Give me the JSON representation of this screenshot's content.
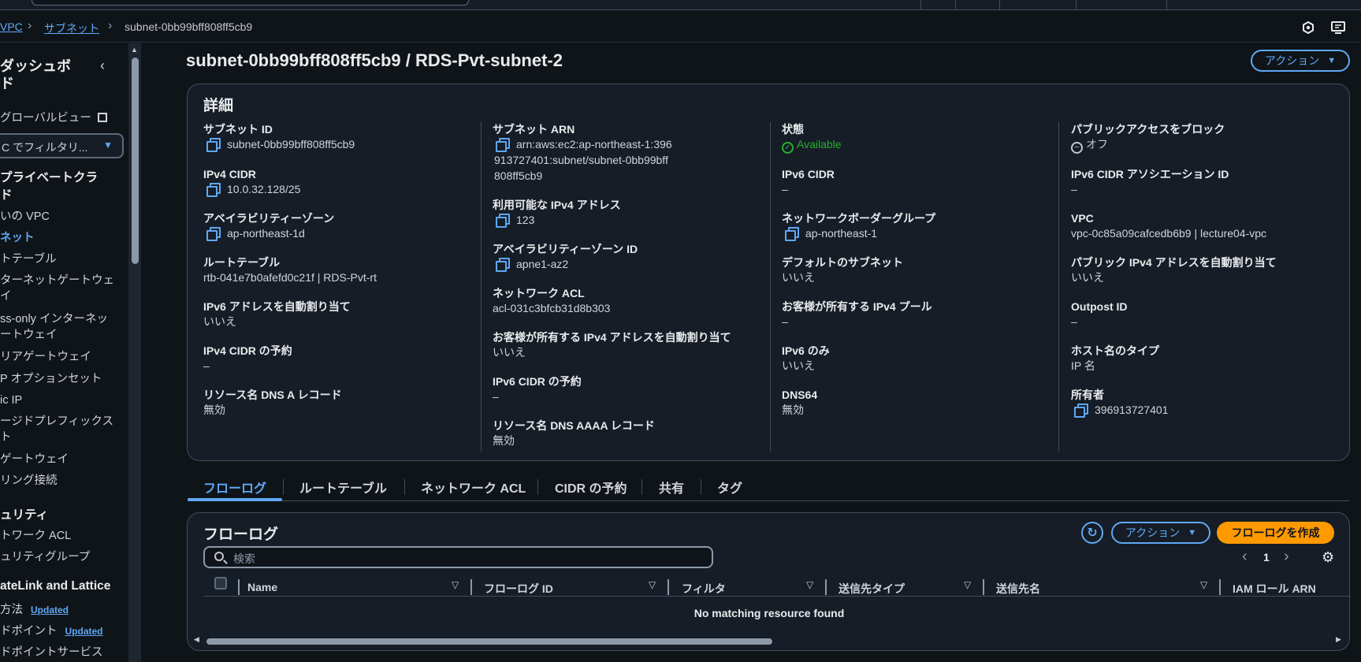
{
  "breadcrumb": {
    "vpc": "VPC",
    "subnets": "サブネット",
    "current": "subnet-0bb99bff808ff5cb9"
  },
  "sidebar": {
    "title": "ダッシュボ",
    "title2": "ド",
    "global_view": "グローバルビュー",
    "filter": "C でフィルタリ...",
    "section_private": "プライベートクラ",
    "section_private2": "ド",
    "items": [
      "いの VPC",
      "ネット",
      "トテーブル",
      "ターネットゲートウェ",
      "イ",
      "ss-only インターネッ",
      "ートウェイ",
      "リアゲートウェイ",
      "P オプションセット",
      "ic IP",
      "ージドプレフィックス",
      "ト",
      "ゲートウェイ",
      "リング接続"
    ],
    "section_security": "ュリティ",
    "security_items": [
      "トワーク ACL",
      "ュリティグループ"
    ],
    "section_privatelink": "ateLink and Lattice",
    "pl_items": [
      "方法",
      "ドポイント",
      "ドポイントサービス"
    ],
    "updated": "Updated"
  },
  "page": {
    "title": "subnet-0bb99bff808ff5cb9 / RDS-Pvt-subnet-2",
    "actions": "アクション"
  },
  "details": {
    "heading": "詳細",
    "col1": [
      {
        "label": "サブネット ID",
        "value": "subnet-0bb99bff808ff5cb9",
        "copy": true
      },
      {
        "label": "IPv4 CIDR",
        "value": "10.0.32.128/25",
        "copy": true
      },
      {
        "label": "アベイラビリティーゾーン",
        "value": "ap-northeast-1d",
        "copy": true
      },
      {
        "label": "ルートテーブル",
        "value": "rtb-041e7b0afefd0c21f | RDS-Pvt-rt",
        "link": true
      },
      {
        "label": "IPv6 アドレスを自動割り当て",
        "value": "いいえ"
      },
      {
        "label": "IPv4 CIDR の予約",
        "value": "–"
      },
      {
        "label": "リソース名 DNS A レコード",
        "value": "無効"
      }
    ],
    "col2": [
      {
        "label": "サブネット ARN",
        "value": "arn:aws:ec2:ap-northeast-1:396913727401:subnet/subnet-0bb99bff808ff5cb9",
        "copy": true
      },
      {
        "label": "利用可能な IPv4 アドレス",
        "value": "123",
        "copy": true
      },
      {
        "label": "アベイラビリティーゾーン ID",
        "value": "apne1-az2",
        "copy": true
      },
      {
        "label": "ネットワーク ACL",
        "value": "acl-031c3bfcb31d8b303",
        "link": true
      },
      {
        "label": "お客様が所有する IPv4 アドレスを自動割り当て",
        "value": "いいえ"
      },
      {
        "label": "IPv6 CIDR の予約",
        "value": "–"
      },
      {
        "label": "リソース名 DNS AAAA レコード",
        "value": "無効"
      }
    ],
    "col3": [
      {
        "label": "状態",
        "value": "Available",
        "status": true
      },
      {
        "label": "IPv6 CIDR",
        "value": "–"
      },
      {
        "label": "ネットワークボーダーグループ",
        "value": "ap-northeast-1",
        "copy": true
      },
      {
        "label": "デフォルトのサブネット",
        "value": "いいえ"
      },
      {
        "label": "お客様が所有する IPv4 プール",
        "value": "–"
      },
      {
        "label": "IPv6 のみ",
        "value": "いいえ"
      },
      {
        "label": "DNS64",
        "value": "無効"
      }
    ],
    "col4": [
      {
        "label": "パブリックアクセスをブロック",
        "value": "オフ",
        "off": true
      },
      {
        "label": "IPv6 CIDR アソシエーション ID",
        "value": "–"
      },
      {
        "label": "VPC",
        "value": "vpc-0c85a09cafcedb6b9 | lecture04-vpc",
        "link": true
      },
      {
        "label": "パブリック IPv4 アドレスを自動割り当て",
        "value": "いいえ"
      },
      {
        "label": "Outpost ID",
        "value": "–"
      },
      {
        "label": "ホスト名のタイプ",
        "value": "IP 名"
      },
      {
        "label": "所有者",
        "value": "396913727401",
        "copy": true
      }
    ]
  },
  "tabs": [
    "フローログ",
    "ルートテーブル",
    "ネットワーク ACL",
    "CIDR の予約",
    "共有",
    "タグ"
  ],
  "flowlogs": {
    "heading": "フローログ",
    "actions": "アクション",
    "create": "フローログを作成",
    "search_placeholder": "検索",
    "page": "1",
    "columns": [
      "Name",
      "フローログ ID",
      "フィルタ",
      "送信先タイプ",
      "送信先名",
      "IAM ロール ARN"
    ],
    "empty": "No matching resource found"
  }
}
